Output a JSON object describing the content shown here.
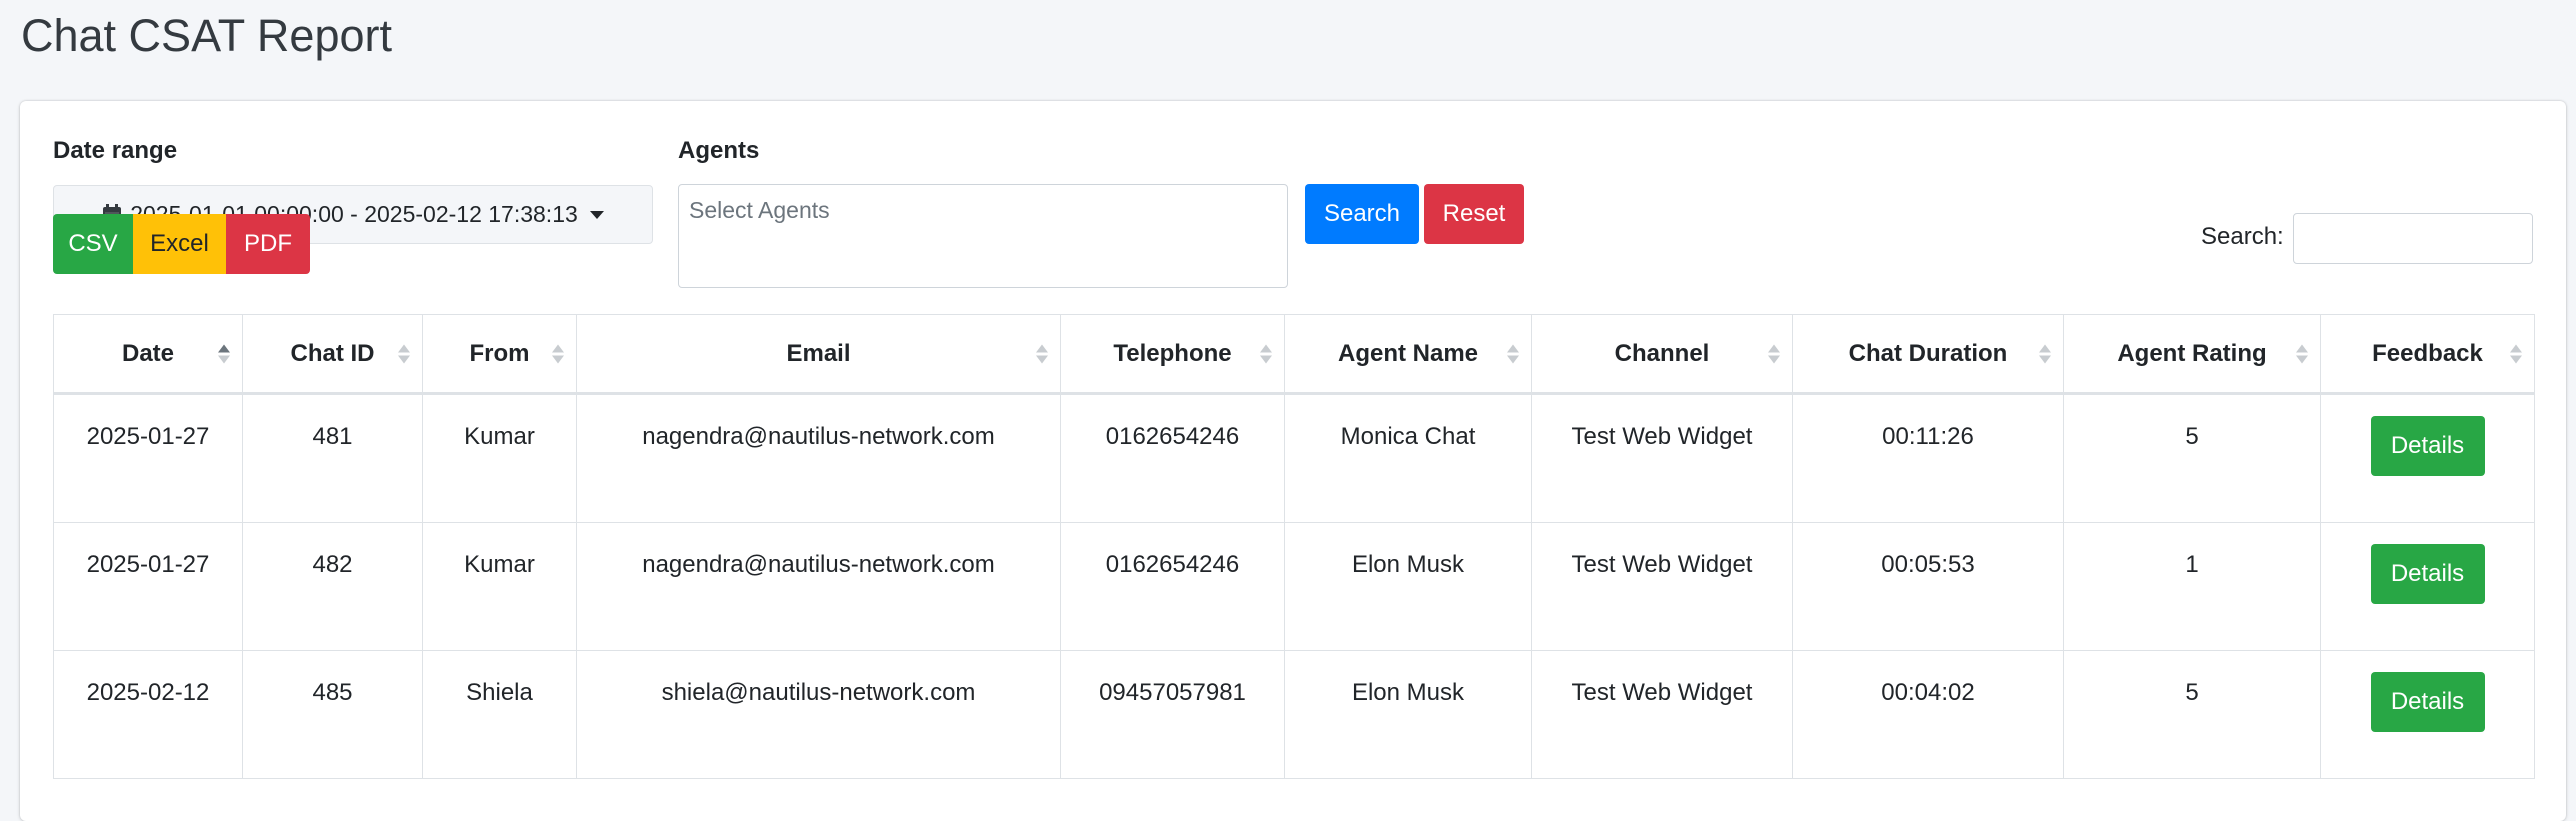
{
  "page": {
    "title": "Chat CSAT Report"
  },
  "filters": {
    "date_range_label": "Date range",
    "date_range_value": "2025-01-01 00:00:00 - 2025-02-12 17:38:13",
    "agents_label": "Agents",
    "agents_placeholder": "Select Agents",
    "search_button": "Search",
    "reset_button": "Reset"
  },
  "export": {
    "csv": "CSV",
    "excel": "Excel",
    "pdf": "PDF"
  },
  "table_search": {
    "label": "Search:"
  },
  "table": {
    "columns": [
      "Date",
      "Chat ID",
      "From",
      "Email",
      "Telephone",
      "Agent Name",
      "Channel",
      "Chat Duration",
      "Agent Rating",
      "Feedback"
    ],
    "rows": [
      {
        "date": "2025-01-27",
        "chat_id": "481",
        "from": "Kumar",
        "email": "nagendra@nautilus-network.com",
        "telephone": "0162654246",
        "agent_name": "Monica Chat",
        "channel": "Test Web Widget",
        "duration": "00:11:26",
        "rating": "5",
        "feedback": "Details"
      },
      {
        "date": "2025-01-27",
        "chat_id": "482",
        "from": "Kumar",
        "email": "nagendra@nautilus-network.com",
        "telephone": "0162654246",
        "agent_name": "Elon Musk",
        "channel": "Test Web Widget",
        "duration": "00:05:53",
        "rating": "1",
        "feedback": "Details"
      },
      {
        "date": "2025-02-12",
        "chat_id": "485",
        "from": "Shiela",
        "email": "shiela@nautilus-network.com",
        "telephone": "09457057981",
        "agent_name": "Elon Musk",
        "channel": "Test Web Widget",
        "duration": "00:04:02",
        "rating": "5",
        "feedback": "Details"
      }
    ]
  },
  "colors": {
    "primary": "#007bff",
    "danger": "#dc3545",
    "success": "#28a745",
    "warning": "#ffc107",
    "background": "#f4f6f9"
  },
  "icons": {
    "calendar": "calendar-icon",
    "caret": "caret-down-icon",
    "sort": "sort-icon"
  }
}
